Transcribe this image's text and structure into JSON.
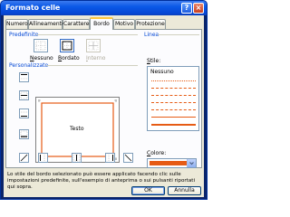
{
  "window": {
    "title": "Formato celle",
    "help_label": "?",
    "close_label": "×"
  },
  "tabs": [
    {
      "label": "Numero"
    },
    {
      "label": "Allineamento"
    },
    {
      "label": "Carattere"
    },
    {
      "label": "Bordo",
      "active": true
    },
    {
      "label": "Motivo"
    },
    {
      "label": "Protezione"
    }
  ],
  "presets": {
    "group_label": "Predefinito",
    "items": [
      {
        "label": "Nessuno",
        "accel": "N",
        "rest": "essuno"
      },
      {
        "label": "Bordato",
        "accel": "B",
        "rest": "ordato"
      },
      {
        "label": "Interno",
        "accel": "I",
        "rest": "nterno",
        "disabled": true
      }
    ]
  },
  "border": {
    "group_label": "Personalizzato",
    "preview_text": "Testo"
  },
  "line": {
    "group_label": "Linea",
    "style_label": "Stile:",
    "style_accel": "S",
    "style_rest": "tile:",
    "none_label": "Nessuno",
    "color_label": "Colore:",
    "color_accel": "C",
    "color_rest": "olore:",
    "selected_color": "#e65b14"
  },
  "info_text": "Lo stile del bordo selezionato può essere applicato facendo clic sulle impostazioni predefinite, sull'esempio di anteprima o sui pulsanti riportati qui sopra.",
  "buttons": {
    "ok_label": "OK",
    "cancel_label": "Annulla"
  },
  "colors": {
    "accent": "#0046d5",
    "border_color": "#e65b14",
    "title_bar": "#0a58e6"
  }
}
